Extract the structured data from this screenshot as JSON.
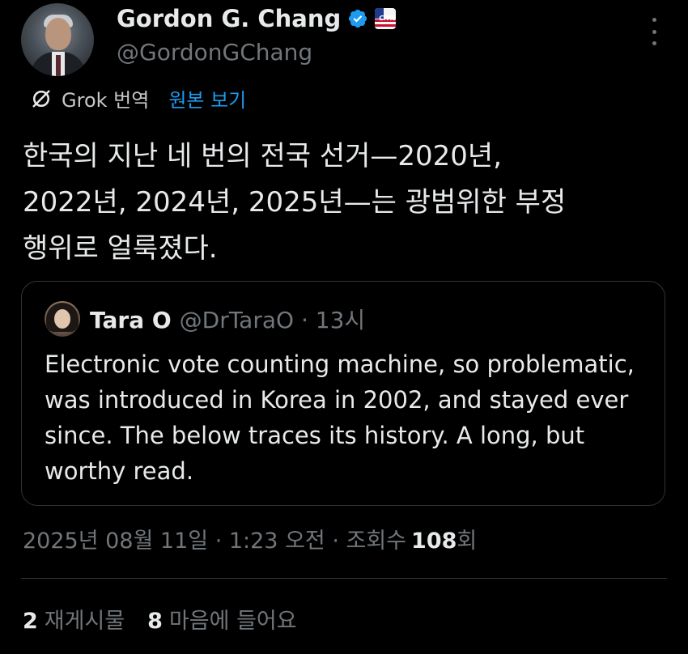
{
  "author": {
    "name": "Gordon G. Chang",
    "handle": "@GordonGChang",
    "verified_color": "#1d9bf0"
  },
  "translate": {
    "label": "Grok 번역",
    "view_original": "원본 보기"
  },
  "tweet": {
    "text": "한국의 지난 네 번의 전국 선거—2020년,\n2022년, 2024년, 2025년—는 광범위한 부정\n행위로 얼룩졌다."
  },
  "quote": {
    "name": "Tara O",
    "handle": "@DrTaraO · 13시",
    "text": "Electronic vote counting machine, so problematic, was introduced in Korea in 2002, and stayed ever since. The below traces its history. A long, but worthy read."
  },
  "meta": {
    "timestamp": "2025년 08월 11일 · 1:23 오전 · 조회수",
    "views": "108",
    "views_suffix": "회"
  },
  "stats": {
    "reposts_count": "2",
    "reposts_label": "재게시물",
    "likes_count": "8",
    "likes_label": "마음에 들어요"
  },
  "colors": {
    "background": "#000000",
    "text": "#e7e9ea",
    "muted": "#71767b",
    "link": "#1d9bf0",
    "border": "#2f3336"
  }
}
